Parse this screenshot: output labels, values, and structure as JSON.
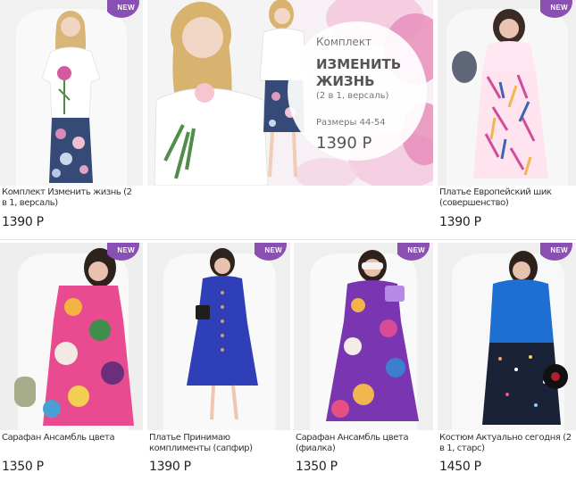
{
  "products": [
    {
      "id": "p1",
      "name": "Комплект Изменить жизнь (2 в 1, версаль)",
      "price": "1390 Р",
      "badge": "NEW"
    },
    {
      "id": "p2",
      "name": "Платье Европейский шик (совершенство)",
      "price": "1390 Р",
      "badge": "NEW"
    },
    {
      "id": "p3",
      "name": "Сарафан Ансамбль цвета",
      "price": "1350 Р",
      "badge": "NEW"
    },
    {
      "id": "p4",
      "name": "Платье Принимаю комплименты (сапфир)",
      "price": "1390 Р",
      "badge": "NEW"
    },
    {
      "id": "p5",
      "name": "Сарафан Ансамбль цвета (фиалка)",
      "price": "1350 Р",
      "badge": "NEW"
    },
    {
      "id": "p6",
      "name": "Костюм Актуально сегодня (2 в 1, старс)",
      "price": "1450 Р",
      "badge": "NEW"
    }
  ],
  "promo": {
    "kicker": "Комплект",
    "title_line1": "ИЗМЕНИТЬ",
    "title_line2": "ЖИЗНЬ",
    "subtitle": "(2 в 1, версаль)",
    "sizes": "Размеры 44-54",
    "price": "1390 Р"
  },
  "colors": {
    "badge": "#8a4fb3",
    "text": "#333333",
    "divider": "#e6e6e6"
  }
}
